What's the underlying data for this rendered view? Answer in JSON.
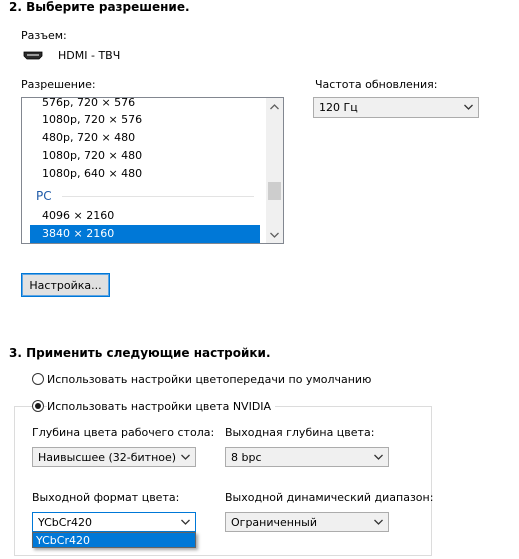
{
  "section2": {
    "title": "2. Выберите разрешение.",
    "connector_label": "Разъем:",
    "connector_value": "HDMI - ТВЧ",
    "resolution_label": "Разрешение:",
    "refresh_label": "Частота обновления:",
    "refresh_value": "120 Гц",
    "resolution_items": [
      "576p, 720 × 576",
      "1080p, 720 × 576",
      "480p, 720 × 480",
      "1080p, 720 × 480",
      "1080p, 640 × 480"
    ],
    "group_label": "PC",
    "pc_items": [
      "4096 × 2160",
      "3840 × 2160"
    ],
    "selected_item": "3840 × 2160",
    "customize_button": "Настройка..."
  },
  "section3": {
    "title": "3. Применить следующие настройки.",
    "radio_default": "Использовать настройки цветопередачи по умолчанию",
    "radio_nvidia": "Использовать настройки цвета NVIDIA",
    "desktop_depth_label": "Глубина цвета рабочего стола:",
    "desktop_depth_value": "Наивысшее (32-битное)",
    "output_depth_label": "Выходная глубина цвета:",
    "output_depth_value": "8 bpc",
    "output_format_label": "Выходной формат цвета:",
    "output_format_value": "YCbCr420",
    "dynamic_range_label": "Выходной динамический диапазон:",
    "dynamic_range_value": "Ограниченный",
    "dropdown_options": [
      "YCbCr420"
    ]
  },
  "icons": {
    "connector": "hdmi-icon",
    "combo_arrow": "chevron-down-icon",
    "scroll_up": "chevron-up-icon",
    "scroll_down": "chevron-down-icon"
  },
  "colors": {
    "selection": "#0078d7",
    "group_header": "#1e5aa8"
  }
}
